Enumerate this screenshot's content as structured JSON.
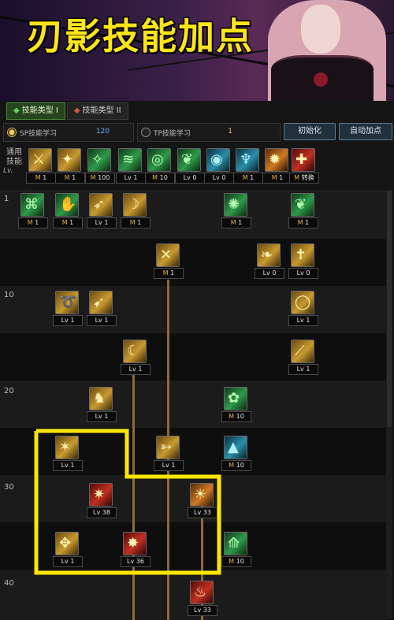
{
  "banner": {
    "title": "刃影技能加点"
  },
  "tabs": [
    {
      "label": "技能类型 I",
      "active": true
    },
    {
      "label": "技能类型 II",
      "active": false
    }
  ],
  "points": {
    "sp_label": "SP技能学习",
    "sp_value": "120",
    "tp_label": "TP技能学习",
    "tp_value": "1"
  },
  "buttons": {
    "reset": "初始化",
    "auto": "自动加点"
  },
  "common_label": "通用\n技能",
  "lv_axis": "Lv.",
  "common_skills": [
    {
      "icon": "dagger-strike-icon",
      "glyph": "⚔",
      "color": "gold",
      "level": "1",
      "badge": true
    },
    {
      "icon": "shadow-strike-icon",
      "glyph": "✦",
      "color": "gold",
      "level": "1",
      "badge": true
    },
    {
      "icon": "green-slash-icon",
      "glyph": "✧",
      "color": "green",
      "level": "100",
      "badge": true
    },
    {
      "icon": "wind-dash-icon",
      "glyph": "≋",
      "color": "green",
      "level": "Lv 1",
      "badge": false
    },
    {
      "icon": "target-eye-icon",
      "glyph": "◎",
      "color": "green",
      "level": "10",
      "badge": true
    },
    {
      "icon": "leap-icon",
      "glyph": "❦",
      "color": "green",
      "level": "Lv 0",
      "badge": false
    },
    {
      "icon": "shield-orb-icon",
      "glyph": "◉",
      "color": "teal",
      "level": "Lv 0",
      "badge": false
    },
    {
      "icon": "armor-icon",
      "glyph": "♆",
      "color": "teal",
      "level": "1",
      "badge": true
    },
    {
      "icon": "fire-slash-icon",
      "glyph": "✹",
      "color": "orange",
      "level": "1",
      "badge": true
    },
    {
      "icon": "swap-icon",
      "glyph": "✚",
      "color": "red",
      "level": "转换",
      "badge": true
    }
  ],
  "row_levels": [
    "1",
    "10",
    "20",
    "30",
    "40"
  ],
  "tree_skills": [
    {
      "icon": "eye-rune-icon",
      "glyph": "⌘",
      "color": "green",
      "level": "1",
      "badge": true
    },
    {
      "icon": "claw-icon",
      "glyph": "✋",
      "color": "green",
      "level": "1",
      "badge": true
    },
    {
      "icon": "kick-icon",
      "glyph": "➶",
      "color": "gold",
      "level": "Lv 1",
      "badge": false
    },
    {
      "icon": "blade-arc-icon",
      "glyph": "☽",
      "color": "gold",
      "level": "1",
      "badge": true
    },
    {
      "icon": "spiral-icon",
      "glyph": "✺",
      "color": "green",
      "level": "1",
      "badge": true
    },
    {
      "icon": "leap-green-icon",
      "glyph": "❦",
      "color": "green",
      "level": "1",
      "badge": true
    },
    {
      "icon": "cross-slash-icon",
      "glyph": "✕",
      "color": "gold",
      "level": "1",
      "badge": true
    },
    {
      "icon": "feather-icon",
      "glyph": "❧",
      "color": "gold",
      "level": "Lv 0",
      "badge": false
    },
    {
      "icon": "cross-shield-icon",
      "glyph": "✝",
      "color": "gold",
      "level": "Lv 0",
      "badge": false
    },
    {
      "icon": "whip-icon",
      "glyph": "➰",
      "color": "gold",
      "level": "Lv 1",
      "badge": false
    },
    {
      "icon": "dash-slash-icon",
      "glyph": "➹",
      "color": "gold",
      "level": "Lv 1",
      "badge": false
    },
    {
      "icon": "ring-icon",
      "glyph": "◯",
      "color": "gold",
      "level": "Lv 1",
      "badge": false
    },
    {
      "icon": "moon-blade-icon",
      "glyph": "☾",
      "color": "gold",
      "level": "Lv 1",
      "badge": false
    },
    {
      "icon": "diagonal-blade-icon",
      "glyph": "⟋",
      "color": "gold",
      "level": "Lv 1",
      "badge": false
    },
    {
      "icon": "shadow-figure-icon",
      "glyph": "♞",
      "color": "gold",
      "level": "Lv 1",
      "badge": false
    },
    {
      "icon": "green-vortex-icon",
      "glyph": "✿",
      "color": "green",
      "level": "10",
      "badge": true
    },
    {
      "icon": "gold-fan-icon",
      "glyph": "✶",
      "color": "gold",
      "level": "Lv 1",
      "badge": false
    },
    {
      "icon": "gold-rush-icon",
      "glyph": "➳",
      "color": "gold",
      "level": "Lv 1",
      "badge": false
    },
    {
      "icon": "teal-crash-icon",
      "glyph": "▲",
      "color": "teal",
      "level": "10",
      "badge": true
    },
    {
      "icon": "awakening-red-icon",
      "glyph": "✷",
      "color": "red",
      "level": "Lv 38",
      "badge": false
    },
    {
      "icon": "fire-wave-icon",
      "glyph": "☀",
      "color": "orange",
      "level": "Lv 33",
      "badge": false
    },
    {
      "icon": "gold-twirl-icon",
      "glyph": "✥",
      "color": "gold",
      "level": "Lv 1",
      "badge": false
    },
    {
      "icon": "red-burst-icon",
      "glyph": "✸",
      "color": "red",
      "level": "Lv 36",
      "badge": false
    },
    {
      "icon": "green-wing-icon",
      "glyph": "⟰",
      "color": "green",
      "level": "10",
      "badge": true
    },
    {
      "icon": "red-flame-icon",
      "glyph": "♨",
      "color": "red",
      "level": "Lv 33",
      "badge": false
    }
  ],
  "colors": {
    "highlight": "#ffe600",
    "connector": "#8a6a3a",
    "banner_text": "#ffe516"
  }
}
